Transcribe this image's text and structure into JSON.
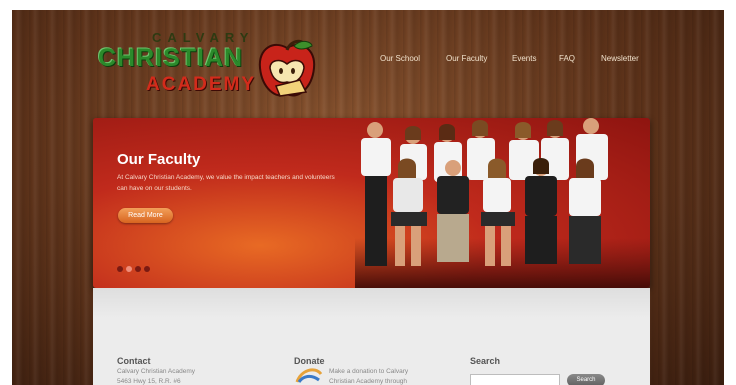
{
  "logo": {
    "line1": "CALVARY",
    "line2": "CHRISTIAN",
    "line3": "ACADEMY"
  },
  "nav": {
    "items": [
      {
        "label": "Our School"
      },
      {
        "label": "Our Faculty"
      },
      {
        "label": "Events"
      },
      {
        "label": "FAQ"
      },
      {
        "label": "Newsletter"
      }
    ]
  },
  "hero": {
    "title": "Our Faculty",
    "text": "At Calvary Christian Academy, we value the impact teachers and volunteers can have on our students.",
    "button_label": "Read More",
    "slides": 4,
    "active_slide": 2
  },
  "footer": {
    "contact": {
      "heading": "Contact",
      "line1": "Calvary Christian Academy",
      "line2": "5463 Hwy 15, R.R. #6"
    },
    "donate": {
      "heading": "Donate",
      "line1": "Make a donation to Calvary",
      "line2": "Christian Academy through"
    },
    "search": {
      "heading": "Search",
      "placeholder": "",
      "button_label": "Search"
    }
  },
  "colors": {
    "hero_red": "#c02a1c",
    "hero_orange": "#e86a24",
    "logo_green": "#2b8a2b",
    "logo_red": "#d32b1b",
    "nav_text": "#f1e2cc",
    "footer_bg": "#ececec"
  }
}
